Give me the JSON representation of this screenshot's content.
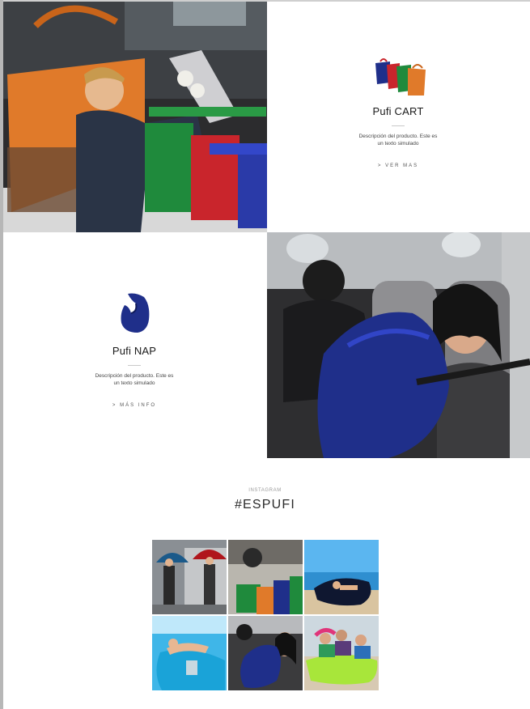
{
  "products": [
    {
      "name": "Pufi CART",
      "description_line1": "Descripción del producto. Este es",
      "description_line2": "un texto simulado",
      "link_label": ">  VER MAS",
      "icon": "cart-bags-icon"
    },
    {
      "name": "Pufi NAP",
      "description_line1": "Descripción del producto. Este es",
      "description_line2": "un texto simulado",
      "link_label": ">  MÁS INFO",
      "icon": "pillow-icon"
    }
  ],
  "instagram": {
    "label": "INSTAGRAM",
    "hashtag": "#ESPUFI",
    "photos": [
      "instagram-photo-umbrellas",
      "instagram-photo-cart-bags",
      "instagram-photo-lounger-beach",
      "instagram-photo-inflatable-water",
      "instagram-photo-nap-pillow",
      "instagram-photo-friends-lounger"
    ]
  },
  "colors": {
    "accent_blue": "#1f2f8a",
    "cart_orange": "#e07a2a",
    "cart_green": "#1f8a3c",
    "cart_red": "#c9252c",
    "lounger_lime": "#a8e63a",
    "lounger_cyan": "#1aa3d8"
  }
}
